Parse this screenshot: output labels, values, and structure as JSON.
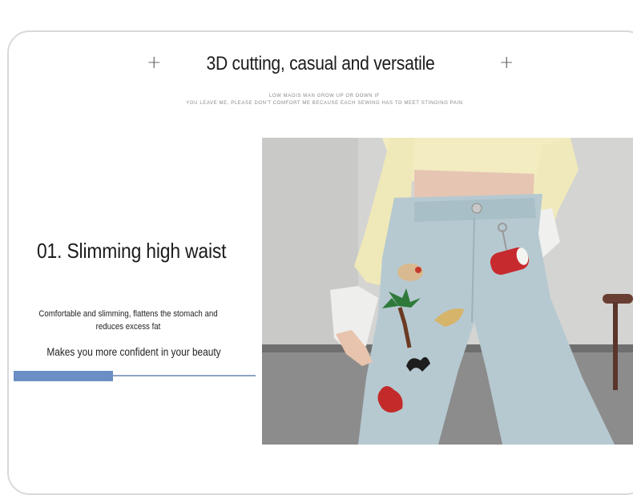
{
  "header": {
    "title": "3D cutting, casual and versatile",
    "subtitle_line1": "LOW MAGIS MAN GROW UP OR DOWN IF",
    "subtitle_line2": "YOU LEAVE ME, PLEASE DON'T COMFORT ME BECAUSE EACH SEWING HAS TO MEET STINGING PAIN",
    "decor_plus": "+"
  },
  "feature": {
    "title": "01. Slimming high waist",
    "description": "Comfortable and slimming, flattens the stomach and reduces excess fat",
    "tagline": "Makes you more confident in your beauty",
    "progress_fraction": 0.41
  },
  "colors": {
    "accent": "#6b8ec4",
    "accent_line": "#8ea3c4",
    "frame": "#d9d9d9"
  },
  "photo": {
    "subject": "light-wash high-waist jeans with embroidered patches",
    "icon": "product-photo"
  }
}
